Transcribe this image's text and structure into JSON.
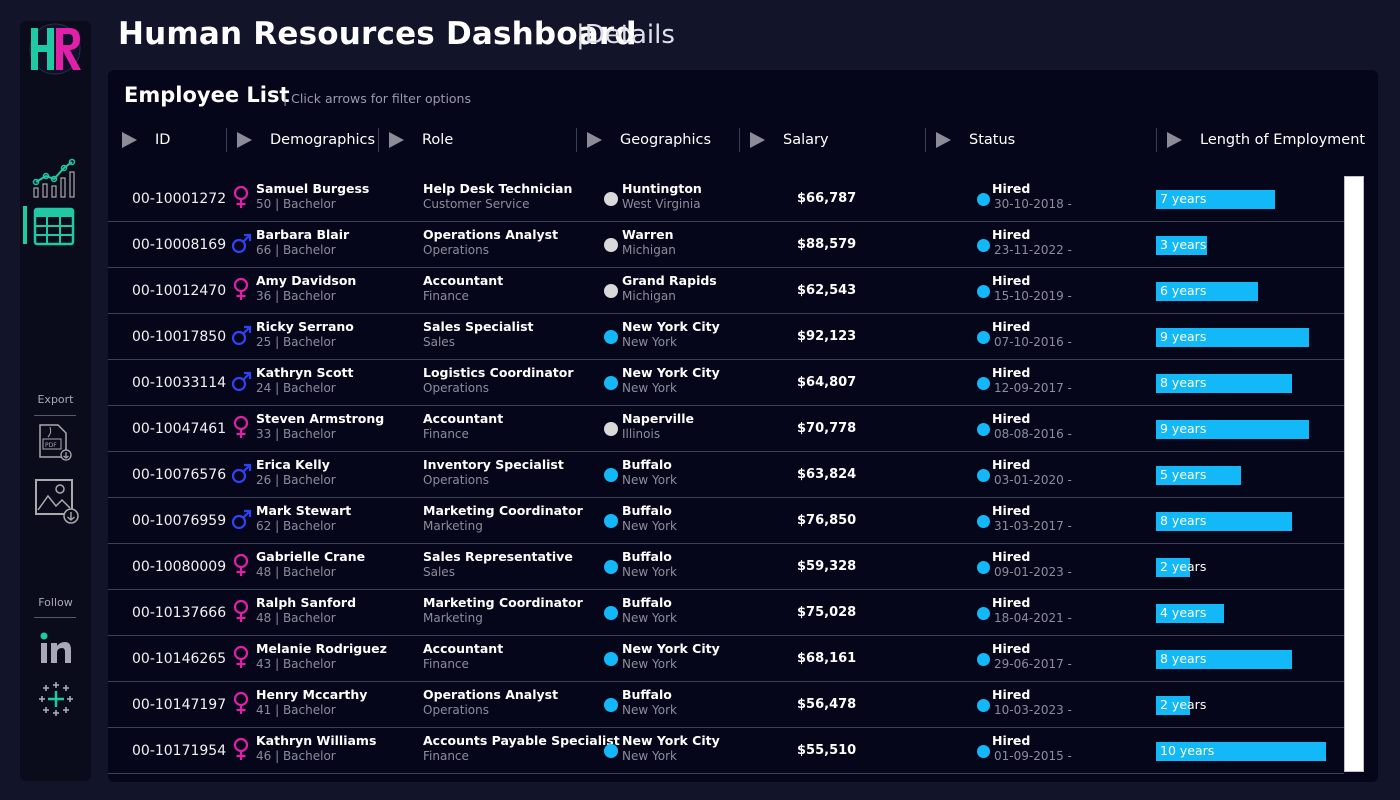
{
  "header": {
    "title": "Human Resources Dashboard",
    "subtitle": "|Details"
  },
  "sidebar": {
    "logo": "HR",
    "export_label": "Export",
    "follow_label": "Follow"
  },
  "panel": {
    "title": "Employee List",
    "hint": "| Click arrows for filter options",
    "columns": [
      "ID",
      "Demographics",
      "Role",
      "Geographics",
      "Salary",
      "Status",
      "Length of Employment"
    ]
  },
  "colors": {
    "female": "#e21fa8",
    "male": "#3042f5",
    "accent": "#12b8f7",
    "city_other": "#d9d9d9",
    "teal": "#1ec9a4"
  },
  "employees": [
    {
      "id": "00-10001272",
      "gender": "female",
      "name": "Samuel Burgess",
      "demo": "50 | Bachelor",
      "role": "Help Desk Technician",
      "dept": "Customer Service",
      "city": "Huntington",
      "state": "West Virginia",
      "dot": "other",
      "salary": "$66,787",
      "status": "Hired",
      "date": "30-10-2018 -",
      "years": 7,
      "years_label": "7 years"
    },
    {
      "id": "00-10008169",
      "gender": "male",
      "name": "Barbara Blair",
      "demo": "66 | Bachelor",
      "role": "Operations Analyst",
      "dept": "Operations",
      "city": "Warren",
      "state": "Michigan",
      "dot": "other",
      "salary": "$88,579",
      "status": "Hired",
      "date": "23-11-2022 -",
      "years": 3,
      "years_label": "3 years"
    },
    {
      "id": "00-10012470",
      "gender": "female",
      "name": "Amy Davidson",
      "demo": "36 | Bachelor",
      "role": "Accountant",
      "dept": "Finance",
      "city": "Grand Rapids",
      "state": "Michigan",
      "dot": "other",
      "salary": "$62,543",
      "status": "Hired",
      "date": "15-10-2019 -",
      "years": 6,
      "years_label": "6 years"
    },
    {
      "id": "00-10017850",
      "gender": "male",
      "name": "Ricky Serrano",
      "demo": "25 | Bachelor",
      "role": "Sales Specialist",
      "dept": "Sales",
      "city": "New York City",
      "state": "New York",
      "dot": "ny",
      "salary": "$92,123",
      "status": "Hired",
      "date": "07-10-2016 -",
      "years": 9,
      "years_label": "9 years"
    },
    {
      "id": "00-10033114",
      "gender": "male",
      "name": "Kathryn Scott",
      "demo": "24 | Bachelor",
      "role": "Logistics Coordinator",
      "dept": "Operations",
      "city": "New York City",
      "state": "New York",
      "dot": "ny",
      "salary": "$64,807",
      "status": "Hired",
      "date": "12-09-2017 -",
      "years": 8,
      "years_label": "8 years"
    },
    {
      "id": "00-10047461",
      "gender": "female",
      "name": "Steven Armstrong",
      "demo": "33 | Bachelor",
      "role": "Accountant",
      "dept": "Finance",
      "city": "Naperville",
      "state": "Illinois",
      "dot": "other",
      "salary": "$70,778",
      "status": "Hired",
      "date": "08-08-2016 -",
      "years": 9,
      "years_label": "9 years"
    },
    {
      "id": "00-10076576",
      "gender": "male",
      "name": "Erica Kelly",
      "demo": "26 | Bachelor",
      "role": "Inventory Specialist",
      "dept": "Operations",
      "city": "Buffalo",
      "state": "New York",
      "dot": "ny",
      "salary": "$63,824",
      "status": "Hired",
      "date": "03-01-2020 -",
      "years": 5,
      "years_label": "5 years"
    },
    {
      "id": "00-10076959",
      "gender": "male",
      "name": "Mark Stewart",
      "demo": "62 | Bachelor",
      "role": "Marketing Coordinator",
      "dept": "Marketing",
      "city": "Buffalo",
      "state": "New York",
      "dot": "ny",
      "salary": "$76,850",
      "status": "Hired",
      "date": "31-03-2017 -",
      "years": 8,
      "years_label": "8 years"
    },
    {
      "id": "00-10080009",
      "gender": "female",
      "name": "Gabrielle Crane",
      "demo": "48 | Bachelor",
      "role": "Sales Representative",
      "dept": "Sales",
      "city": "Buffalo",
      "state": "New York",
      "dot": "ny",
      "salary": "$59,328",
      "status": "Hired",
      "date": "09-01-2023 -",
      "years": 2,
      "years_label": "2 years"
    },
    {
      "id": "00-10137666",
      "gender": "female",
      "name": "Ralph Sanford",
      "demo": "48 | Bachelor",
      "role": "Marketing Coordinator",
      "dept": "Marketing",
      "city": "Buffalo",
      "state": "New York",
      "dot": "ny",
      "salary": "$75,028",
      "status": "Hired",
      "date": "18-04-2021 -",
      "years": 4,
      "years_label": "4 years"
    },
    {
      "id": "00-10146265",
      "gender": "female",
      "name": "Melanie Rodriguez",
      "demo": "43 | Bachelor",
      "role": "Accountant",
      "dept": "Finance",
      "city": "New York City",
      "state": "New York",
      "dot": "ny",
      "salary": "$68,161",
      "status": "Hired",
      "date": "29-06-2017 -",
      "years": 8,
      "years_label": "8 years"
    },
    {
      "id": "00-10147197",
      "gender": "female",
      "name": "Henry Mccarthy",
      "demo": "41 | Bachelor",
      "role": "Operations Analyst",
      "dept": "Operations",
      "city": "Buffalo",
      "state": "New York",
      "dot": "ny",
      "salary": "$56,478",
      "status": "Hired",
      "date": "10-03-2023 -",
      "years": 2,
      "years_label": "2 years"
    },
    {
      "id": "00-10171954",
      "gender": "female",
      "name": "Kathryn Williams",
      "demo": "46 | Bachelor",
      "role": "Accounts Payable Specialist",
      "dept": "Finance",
      "city": "New York City",
      "state": "New York",
      "dot": "ny",
      "salary": "$55,510",
      "status": "Hired",
      "date": "01-09-2015 -",
      "years": 10,
      "years_label": "10 years"
    }
  ]
}
